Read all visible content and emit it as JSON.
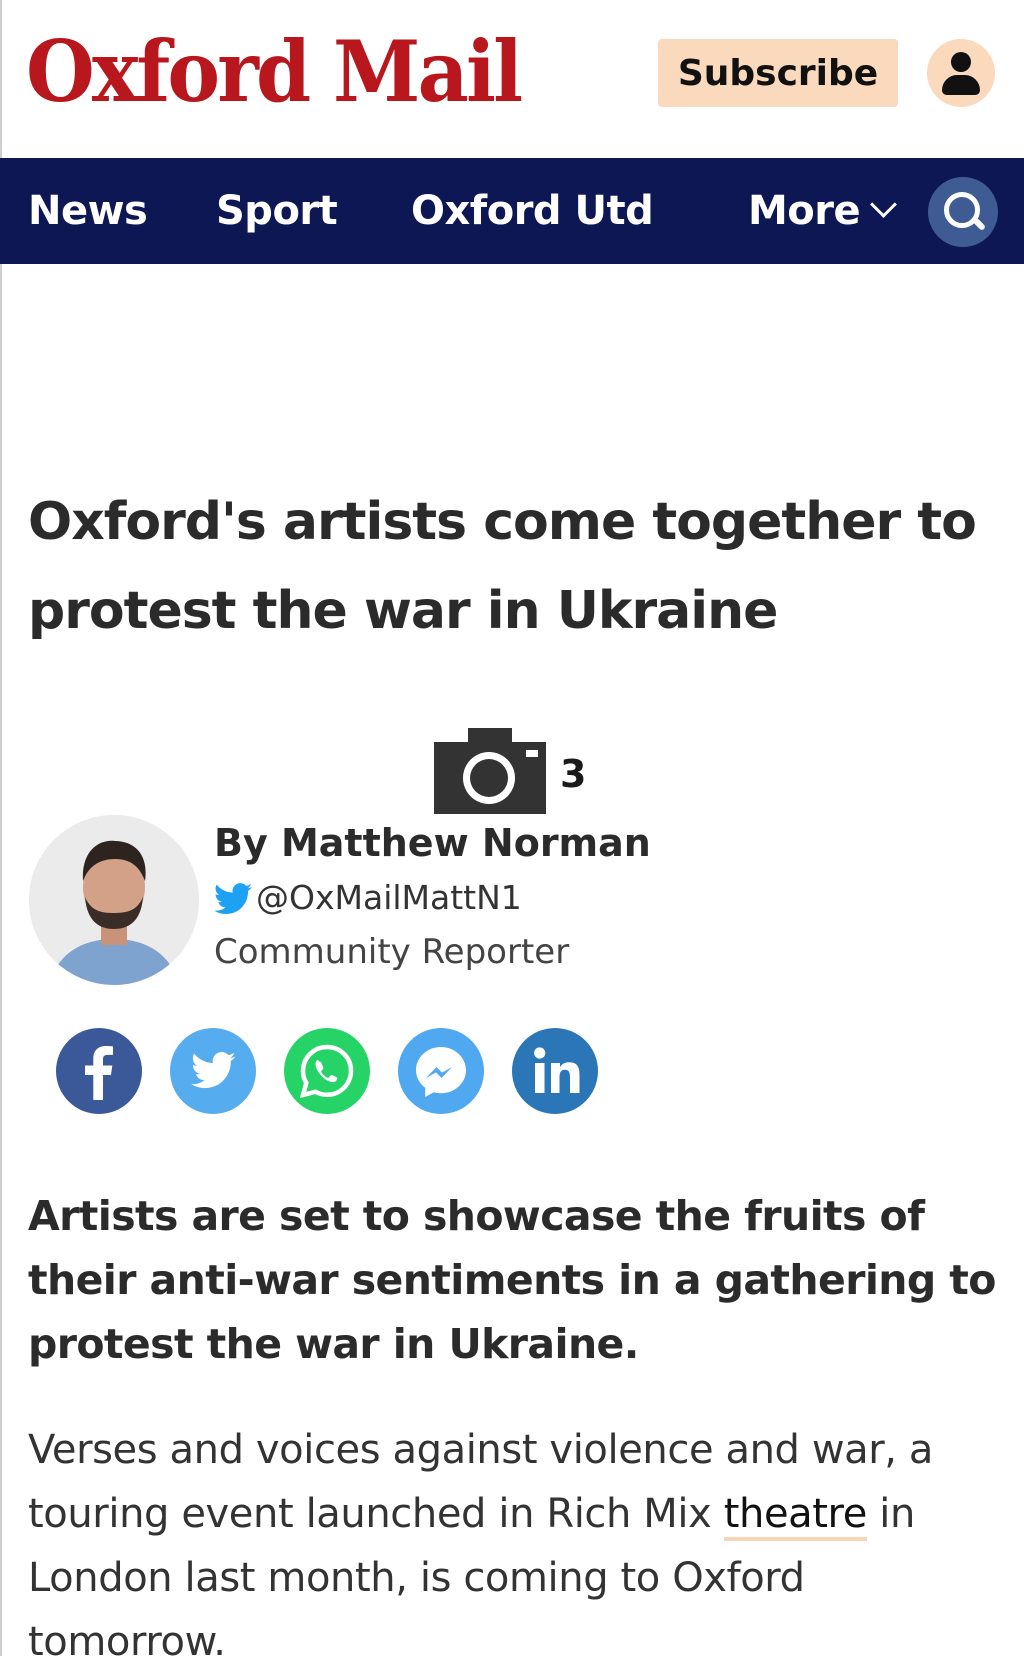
{
  "header": {
    "logo": "Oxford Mail",
    "subscribe_label": "Subscribe",
    "account_icon": "user-icon"
  },
  "nav": {
    "items": [
      {
        "label": "News"
      },
      {
        "label": "Sport"
      },
      {
        "label": "Oxford Utd"
      },
      {
        "label": "More"
      }
    ],
    "search_icon": "search-icon",
    "more_icon": "chevron-down-icon"
  },
  "article": {
    "headline": "Oxford's artists come together to protest the war in Ukraine",
    "gallery": {
      "icon": "camera-icon",
      "count": "3"
    },
    "author": {
      "byline": "By Matthew Norman",
      "twitter_handle": "@OxMailMattN1",
      "role": "Community Reporter"
    },
    "share": [
      {
        "network": "facebook",
        "icon": "facebook-icon",
        "color": "#3b5998"
      },
      {
        "network": "twitter",
        "icon": "twitter-icon",
        "color": "#55acee"
      },
      {
        "network": "whatsapp",
        "icon": "whatsapp-icon",
        "color": "#25d366"
      },
      {
        "network": "messenger",
        "icon": "messenger-icon",
        "color": "#4fa8f0"
      },
      {
        "network": "linkedin",
        "icon": "linkedin-icon",
        "color": "#2b76b6"
      }
    ],
    "standfirst": "Artists are set to showcase the fruits of their anti-war sentiments in a gathering to protest the war in Ukraine.",
    "body": {
      "before": "Verses and voices against violence and war, a touring event launched in Rich Mix ",
      "keyword": "theatre",
      "after": " in London last month, is coming to Oxford tomorrow."
    }
  },
  "colors": {
    "brand_red": "#b8171d",
    "nav_navy": "#0c1753",
    "subscribe_bg": "#fbd9bd",
    "search_bg": "#3f5b94"
  }
}
